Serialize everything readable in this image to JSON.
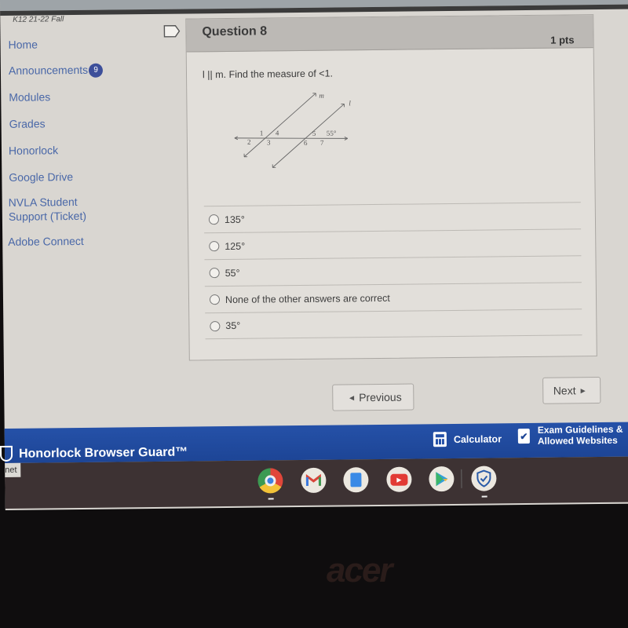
{
  "course": {
    "label": "K12 21-22 Fall"
  },
  "sidebar": {
    "items": [
      {
        "label": "Home"
      },
      {
        "label": "Announcements",
        "badge": "9"
      },
      {
        "label": "Modules"
      },
      {
        "label": "Grades"
      },
      {
        "label": "Honorlock"
      },
      {
        "label": "Google Drive"
      },
      {
        "label": "NVLA Student Support (Ticket)"
      },
      {
        "label": "Adobe Connect"
      }
    ]
  },
  "question": {
    "title": "Question 8",
    "points": "1 pts",
    "prompt": "l || m. Find the measure of <1.",
    "figure": {
      "line_labels": [
        "m",
        "l"
      ],
      "angle_labels": [
        "1",
        "2",
        "3",
        "4",
        "5",
        "6",
        "7"
      ],
      "given_angle": "55°"
    },
    "answers": [
      {
        "label": "135°",
        "selected": false
      },
      {
        "label": "125°",
        "selected": false
      },
      {
        "label": "55°",
        "selected": false
      },
      {
        "label": "None of the other answers are correct",
        "selected": false
      },
      {
        "label": "35°",
        "selected": false
      }
    ]
  },
  "navigation": {
    "previous": "Previous",
    "next": "Next"
  },
  "honorlock": {
    "title": "Honorlock Browser Guard™",
    "calculator": "Calculator",
    "guidelines_line1": "Exam Guidelines &",
    "guidelines_line2": "Allowed Websites"
  },
  "tooltip": {
    "text": "net"
  },
  "shelf": {
    "apps": [
      "chrome-icon",
      "gmail-icon",
      "docs-icon",
      "youtube-icon",
      "play-store-icon",
      "honorlock-shield-icon"
    ]
  },
  "bezel": {
    "brand": "acer"
  }
}
